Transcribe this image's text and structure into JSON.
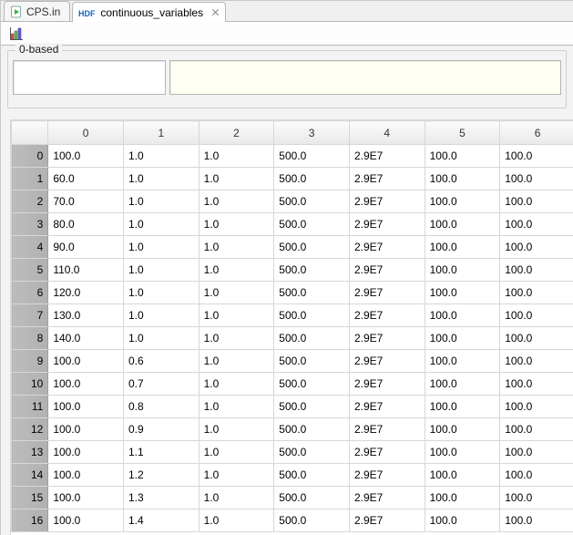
{
  "tabs": [
    {
      "label": "CPS.in",
      "active": false,
      "closable": false,
      "icon": "play-file-icon"
    },
    {
      "label": "continuous_variables",
      "active": true,
      "closable": true,
      "icon": "hdf-icon"
    }
  ],
  "toolbar": {
    "items": [
      {
        "name": "chart-icon"
      }
    ]
  },
  "group": {
    "legend": "0-based",
    "left_value": "",
    "right_value": ""
  },
  "table": {
    "col_headers": [
      "0",
      "1",
      "2",
      "3",
      "4",
      "5",
      "6"
    ],
    "row_headers": [
      "0",
      "1",
      "2",
      "3",
      "4",
      "5",
      "6",
      "7",
      "8",
      "9",
      "10",
      "11",
      "12",
      "13",
      "14",
      "15",
      "16"
    ],
    "rows": [
      [
        "100.0",
        "1.0",
        "1.0",
        "500.0",
        "2.9E7",
        "100.0",
        "100.0"
      ],
      [
        "60.0",
        "1.0",
        "1.0",
        "500.0",
        "2.9E7",
        "100.0",
        "100.0"
      ],
      [
        "70.0",
        "1.0",
        "1.0",
        "500.0",
        "2.9E7",
        "100.0",
        "100.0"
      ],
      [
        "80.0",
        "1.0",
        "1.0",
        "500.0",
        "2.9E7",
        "100.0",
        "100.0"
      ],
      [
        "90.0",
        "1.0",
        "1.0",
        "500.0",
        "2.9E7",
        "100.0",
        "100.0"
      ],
      [
        "110.0",
        "1.0",
        "1.0",
        "500.0",
        "2.9E7",
        "100.0",
        "100.0"
      ],
      [
        "120.0",
        "1.0",
        "1.0",
        "500.0",
        "2.9E7",
        "100.0",
        "100.0"
      ],
      [
        "130.0",
        "1.0",
        "1.0",
        "500.0",
        "2.9E7",
        "100.0",
        "100.0"
      ],
      [
        "140.0",
        "1.0",
        "1.0",
        "500.0",
        "2.9E7",
        "100.0",
        "100.0"
      ],
      [
        "100.0",
        "0.6",
        "1.0",
        "500.0",
        "2.9E7",
        "100.0",
        "100.0"
      ],
      [
        "100.0",
        "0.7",
        "1.0",
        "500.0",
        "2.9E7",
        "100.0",
        "100.0"
      ],
      [
        "100.0",
        "0.8",
        "1.0",
        "500.0",
        "2.9E7",
        "100.0",
        "100.0"
      ],
      [
        "100.0",
        "0.9",
        "1.0",
        "500.0",
        "2.9E7",
        "100.0",
        "100.0"
      ],
      [
        "100.0",
        "1.1",
        "1.0",
        "500.0",
        "2.9E7",
        "100.0",
        "100.0"
      ],
      [
        "100.0",
        "1.2",
        "1.0",
        "500.0",
        "2.9E7",
        "100.0",
        "100.0"
      ],
      [
        "100.0",
        "1.3",
        "1.0",
        "500.0",
        "2.9E7",
        "100.0",
        "100.0"
      ],
      [
        "100.0",
        "1.4",
        "1.0",
        "500.0",
        "2.9E7",
        "100.0",
        "100.0"
      ]
    ]
  }
}
